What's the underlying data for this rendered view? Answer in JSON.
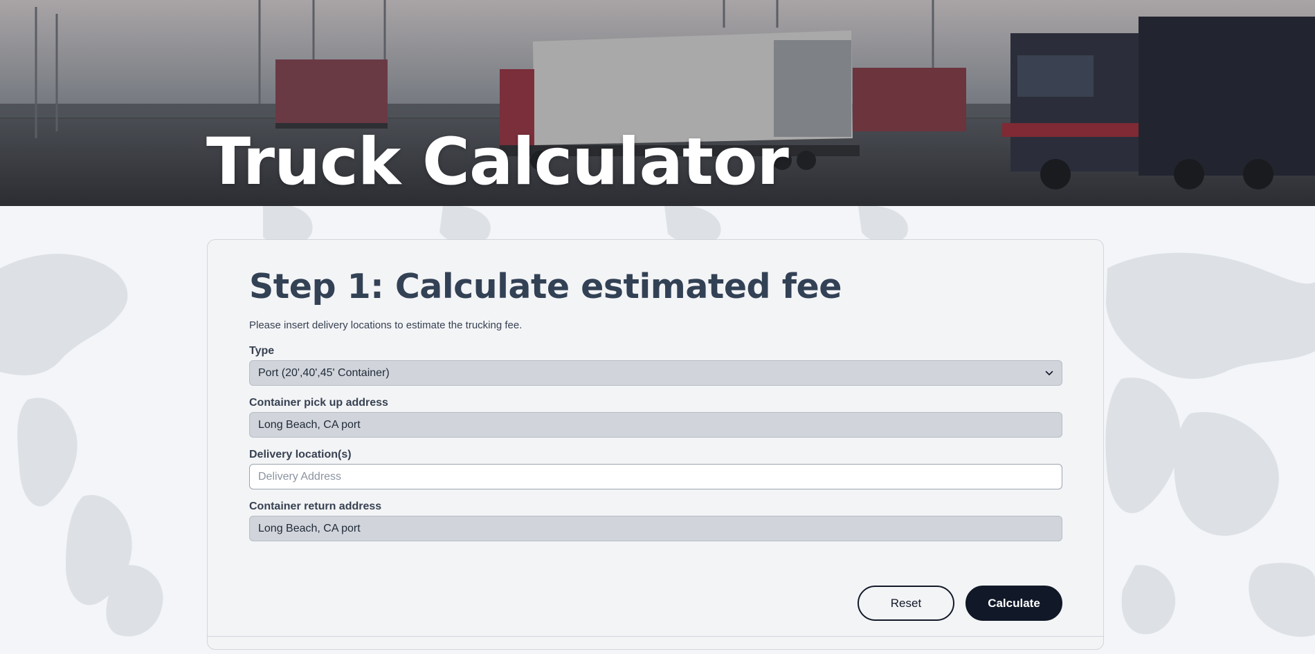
{
  "hero": {
    "title": "Truck Calculator"
  },
  "step": {
    "heading": "Step 1: Calculate estimated fee",
    "subtitle": "Please insert delivery locations to estimate the trucking fee."
  },
  "form": {
    "type": {
      "label": "Type",
      "value": "Port (20',40',45' Container)"
    },
    "pickup": {
      "label": "Container pick up address",
      "value": "Long Beach, CA port"
    },
    "delivery": {
      "label": "Delivery location(s)",
      "value": "",
      "placeholder": "Delivery Address"
    },
    "return": {
      "label": "Container return address",
      "value": "Long Beach, CA port"
    }
  },
  "buttons": {
    "reset": "Reset",
    "calculate": "Calculate"
  },
  "colors": {
    "primary_button": "#111827",
    "heading": "#334155",
    "readonly_field": "#d1d5db"
  },
  "icons": {
    "select_chevron": "chevron-down-icon"
  }
}
